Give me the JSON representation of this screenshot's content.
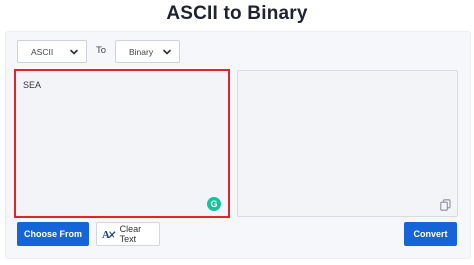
{
  "page": {
    "title": "ASCII to Binary"
  },
  "controls": {
    "from_select": {
      "value": "ASCII"
    },
    "to_label": "To",
    "to_select": {
      "value": "Binary"
    }
  },
  "editor": {
    "input_text": "SEA",
    "output_text": ""
  },
  "buttons": {
    "choose_from": "Choose From",
    "clear_text": "Clear Text",
    "convert": "Convert"
  },
  "icons": {
    "dropdown": "chevron-down-icon",
    "grammarly": "grammarly-icon",
    "copy": "copy-icon",
    "clear": "clear-text-icon"
  },
  "colors": {
    "accent": "#1565d8",
    "input_border_highlight": "#e0262a",
    "grammarly": "#15c39a"
  }
}
